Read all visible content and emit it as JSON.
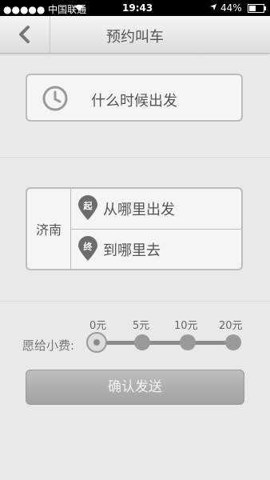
{
  "status_bar": {
    "carrier": "●●●●● 中国联通",
    "time": "19:43",
    "battery": "44%"
  },
  "nav": {
    "title": "预约叫车"
  },
  "time_select": {
    "label": "什么时候出发",
    "icon": "clock-icon"
  },
  "route": {
    "city": "济南",
    "from": {
      "pin_char": "起",
      "label": "从哪里出发"
    },
    "to": {
      "pin_char": "终",
      "label": "到哪里去"
    }
  },
  "tip": {
    "label": "愿给小费:",
    "options": [
      "0元",
      "5元",
      "10元",
      "20元"
    ],
    "selected": "0元"
  },
  "confirm_button": {
    "label": "确认发送"
  },
  "colors": {
    "status_bar_bg": "#000000",
    "page_bg": "#e9e9e9",
    "button_bg": "#a8a8a8"
  }
}
